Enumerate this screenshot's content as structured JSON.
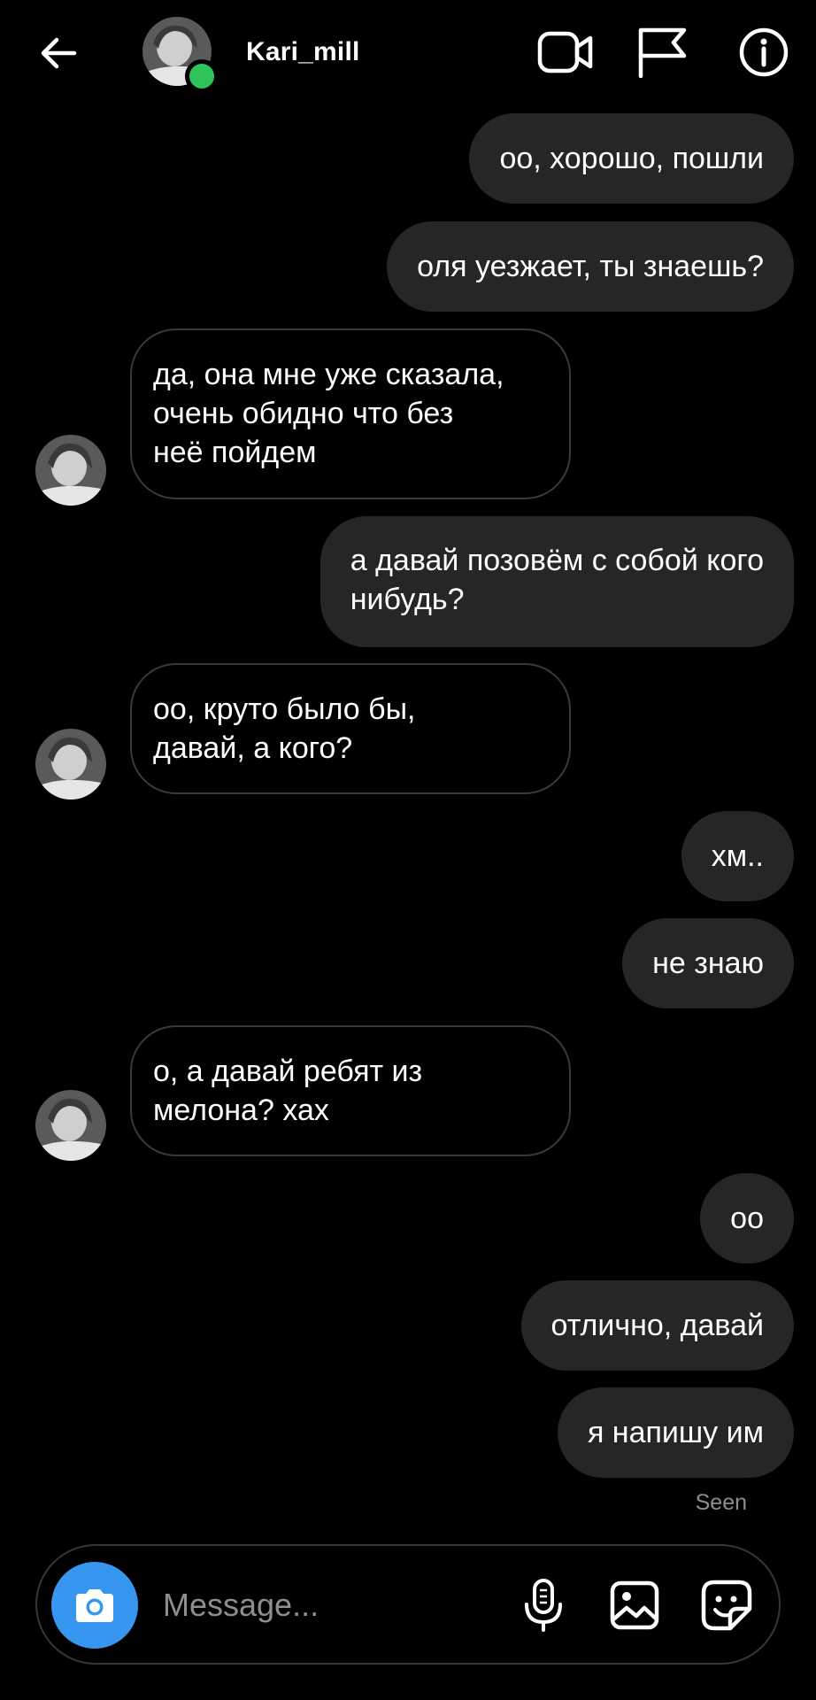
{
  "header": {
    "username": "Kari_mill",
    "icons": [
      "back-arrow-icon",
      "video-call-icon",
      "flag-icon",
      "info-icon"
    ],
    "online": true,
    "online_color": "#2fc45a"
  },
  "messages": [
    {
      "side": "out",
      "text": "оо, хорошо, пошли"
    },
    {
      "side": "out",
      "text": "оля уезжает, ты знаешь?"
    },
    {
      "side": "in",
      "text": "да, она мне уже сказала,\nочень обидно что без\nнеё пойдем"
    },
    {
      "side": "out",
      "text": "а давай позовём с собой кого\nнибудь?"
    },
    {
      "side": "in",
      "text": "оо, круто было бы,\nдавай, а кого?"
    },
    {
      "side": "out",
      "text": "хм.."
    },
    {
      "side": "out",
      "text": "не знаю"
    },
    {
      "side": "in",
      "text": "о, а давай ребят из\nмелона? хах"
    },
    {
      "side": "out",
      "text": "оо"
    },
    {
      "side": "out",
      "text": "отлично, давай"
    },
    {
      "side": "out",
      "text": "я напишу им"
    }
  ],
  "seen_label": "Seen",
  "composer": {
    "placeholder": "Message...",
    "icons": [
      "camera-icon",
      "microphone-icon",
      "gallery-icon",
      "sticker-icon"
    ],
    "camera_color": "#3797f0"
  },
  "colors": {
    "background": "#000000",
    "outgoing_bubble": "#262628",
    "incoming_border": "#3a3a3c",
    "muted_text": "#8e8e8e"
  }
}
